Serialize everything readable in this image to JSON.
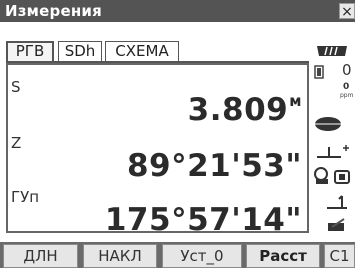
{
  "window": {
    "title": "Измерения",
    "close_label": "×"
  },
  "tabs": [
    {
      "label": "РГВ",
      "active": true
    },
    {
      "label": "SDh",
      "active": false
    },
    {
      "label": "СХЕМА",
      "active": false
    }
  ],
  "measurements": [
    {
      "label": "S",
      "value": "3.809",
      "unit": "м"
    },
    {
      "label": "Z",
      "value": "89°21'53\"",
      "unit": ""
    },
    {
      "label": "ГУп",
      "value": "175°57'14\"",
      "unit": ""
    }
  ],
  "status_icons": {
    "signal_icon": "signal-strength-icon",
    "prism_constant_value": "0",
    "ppm_value": "0",
    "ppm_label": "ppm",
    "target_icon": "laser-target-icon",
    "tilt_icon": "tilt-compensation-icon",
    "battery_mode_icon": "measurement-mode-icon",
    "page_icon": "page-1-icon",
    "edit_icon": "pen-input-icon"
  },
  "softkeys": [
    {
      "label": "ДЛН",
      "bold": false
    },
    {
      "label": "НАКЛ",
      "bold": false
    },
    {
      "label": "Уст_0",
      "bold": false
    },
    {
      "label": "Расст",
      "bold": true
    },
    {
      "label": "С1",
      "bold": false
    }
  ],
  "colors": {
    "titlebar_bg": "#545454",
    "softkey_bar_bg": "#6a6a6a",
    "softkey_bg": "#e6e6e6"
  }
}
